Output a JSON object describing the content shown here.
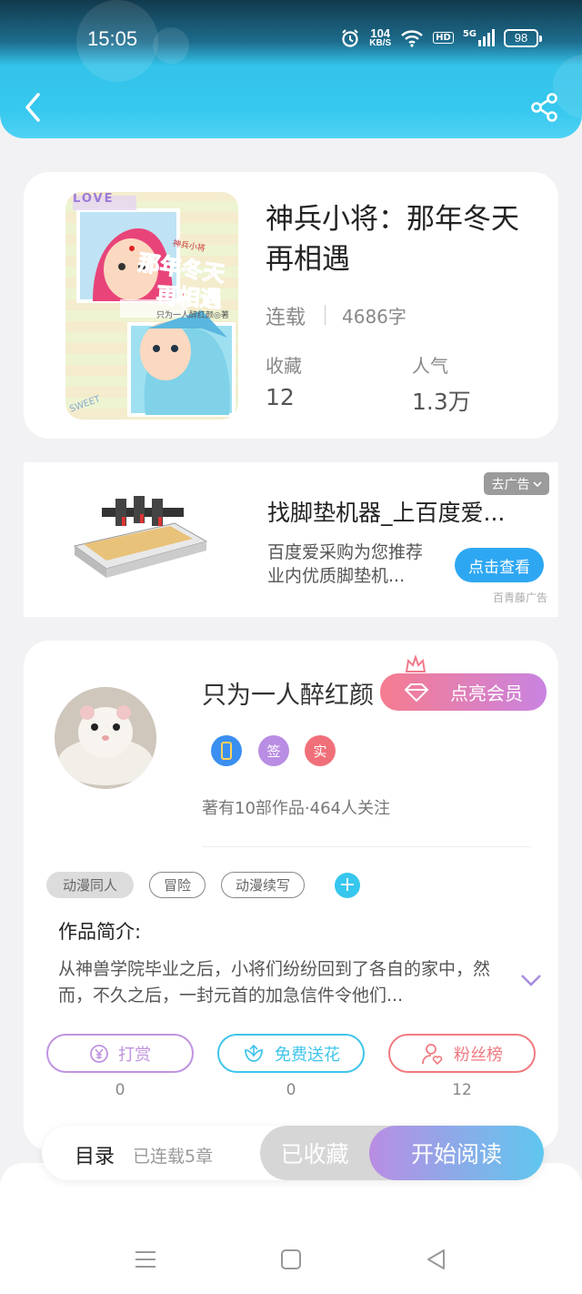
{
  "status_bar": {
    "time": "15:05",
    "net_speed_value": "104",
    "net_speed_unit": "KB/S",
    "hd_label": "HD",
    "signal_label": "5G",
    "battery": "98"
  },
  "header": {
    "back_icon": "chevron-left-icon",
    "share_icon": "share-icon"
  },
  "book": {
    "title": "神兵小将：那年冬天再相遇",
    "status": "连载",
    "word_count": "4686字",
    "collect_label": "收藏",
    "collect_value": "12",
    "popularity_label": "人气",
    "popularity_value": "1.3万",
    "cover": {
      "top_tags": "LOVE",
      "title_line1": "那年冬天",
      "title_line2": "再相遇",
      "subtitle": "神兵小将",
      "author_credit": "只为一人醉红颜◎著",
      "bottom_text": "SWEET"
    }
  },
  "ad": {
    "title": "找脚垫机器_上百度爱...",
    "description": "百度爱采购为您推荐业内优质脚垫机...",
    "cta": "点击查看",
    "close_label": "去广告",
    "source": "百青藤广告"
  },
  "author": {
    "name": "只为一人醉红颜",
    "vip_button": "点亮会员",
    "badges": [
      {
        "icon": "phone-badge-icon",
        "label": "",
        "color": "#3a8ff0"
      },
      {
        "icon": "sign-badge-icon",
        "label": "签",
        "color": "#b98de3"
      },
      {
        "icon": "verified-badge-icon",
        "label": "实",
        "color": "#f0707a"
      }
    ],
    "meta": "著有10部作品·464人关注"
  },
  "tags": [
    {
      "label": "动漫同人",
      "style": "filled"
    },
    {
      "label": "冒险",
      "style": "outline"
    },
    {
      "label": "动漫续写",
      "style": "outline"
    }
  ],
  "intro": {
    "title": "作品简介:",
    "text": "从神兽学院毕业之后，小将们纷纷回到了各自的家中，然而，不久之后，一封元首的加急信件令他们..."
  },
  "actions": [
    {
      "label": "打赏",
      "icon": "yen-icon",
      "count": "0",
      "color": "#c093e0"
    },
    {
      "label": "免费送花",
      "icon": "flower-icon",
      "count": "0",
      "color": "#3fc5ea"
    },
    {
      "label": "粉丝榜",
      "icon": "fan-user-icon",
      "count": "12",
      "color": "#f07a80"
    }
  ],
  "bottom_bar": {
    "toc_label": "目录",
    "toc_count": "已连载5章",
    "collected_label": "已收藏",
    "read_label": "开始阅读"
  },
  "nav": {
    "menu_icon": "menu-icon",
    "home_icon": "home-square-icon",
    "back_icon": "back-triangle-icon"
  }
}
